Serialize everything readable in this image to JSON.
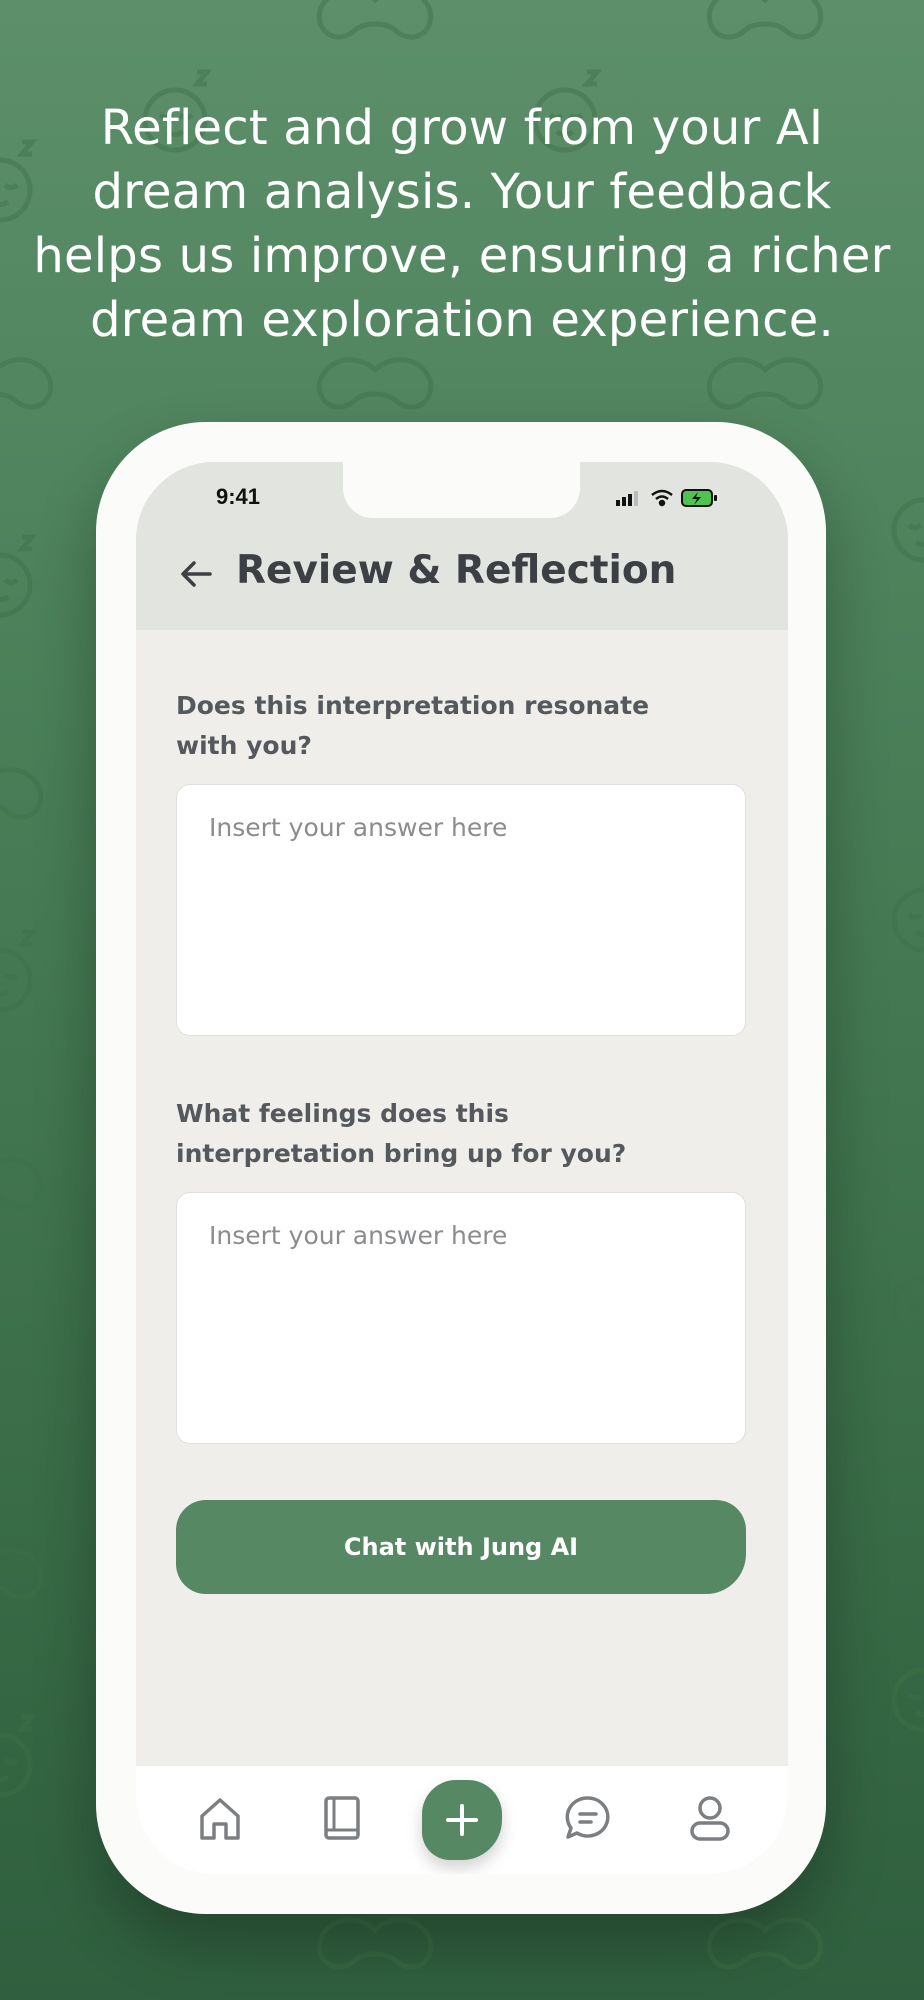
{
  "headline": "Reflect and grow from your AI dream analysis. Your feedback helps us improve, ensuring a richer dream exploration experience.",
  "status_bar": {
    "time": "9:41"
  },
  "header": {
    "title": "Review & Reflection"
  },
  "questions": [
    {
      "label": "Does this interpretation resonate with you?",
      "placeholder": "Insert your answer here",
      "value": ""
    },
    {
      "label": "What feelings does this interpretation bring up for you?",
      "placeholder": "Insert your answer here",
      "value": ""
    }
  ],
  "chat_button": {
    "label": "Chat with Jung AI"
  },
  "tabbar": {
    "items": [
      {
        "icon": "home-icon"
      },
      {
        "icon": "journal-icon"
      },
      {
        "icon": "plus-icon"
      },
      {
        "icon": "chat-icon"
      },
      {
        "icon": "profile-icon"
      }
    ]
  },
  "colors": {
    "background": "#4a7f58",
    "accent": "#568963",
    "header_bg": "#e2e4df",
    "screen_bg": "#efeeea",
    "title_text": "#3c3f44"
  }
}
